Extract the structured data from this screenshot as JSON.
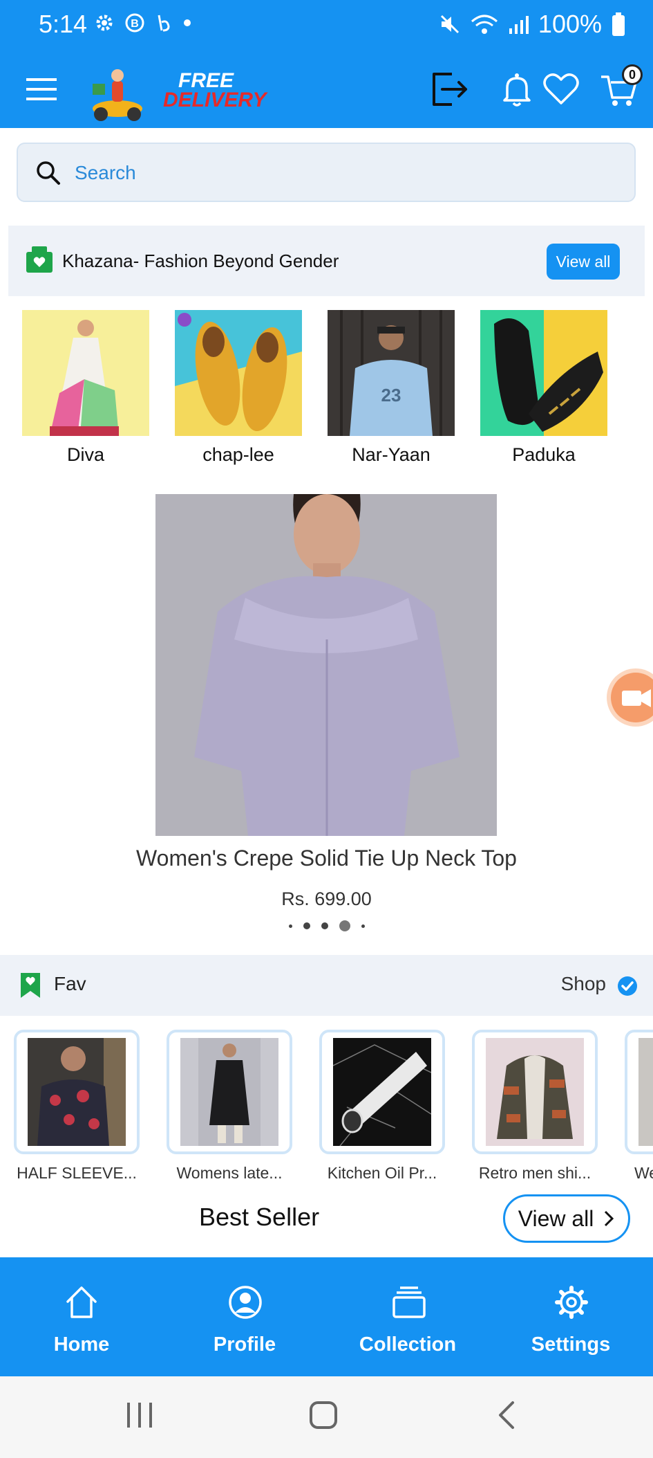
{
  "status_bar": {
    "time": "5:14",
    "battery": "100%"
  },
  "header": {
    "logo_line1": "FREE",
    "logo_line2": "DELIVERY",
    "cart_count": "0"
  },
  "search": {
    "placeholder": "Search"
  },
  "khazana": {
    "title": "Khazana- Fashion Beyond Gender",
    "view_all": "View all"
  },
  "categories": [
    {
      "label": "Diva"
    },
    {
      "label": "chap-lee"
    },
    {
      "label": "Nar-Yaan"
    },
    {
      "label": "Paduka"
    }
  ],
  "carousel": {
    "title": "Women's Crepe Solid Tie Up Neck Top",
    "price": "Rs. 699.00",
    "active_index": 3,
    "slide_count": 5
  },
  "fav": {
    "title": "Fav",
    "shop": "Shop"
  },
  "fav_items": [
    {
      "label": "HALF SLEEVE..."
    },
    {
      "label": "Womens late..."
    },
    {
      "label": "Kitchen Oil Pr..."
    },
    {
      "label": "Retro men shi..."
    },
    {
      "label": "We"
    }
  ],
  "best_seller": {
    "title": "Best Seller",
    "view_all": "View all"
  },
  "bottom_nav": [
    {
      "label": "Home"
    },
    {
      "label": "Profile"
    },
    {
      "label": "Collection"
    },
    {
      "label": "Settings"
    }
  ],
  "colors": {
    "primary": "#1592f2",
    "section_bg": "#eef2f8",
    "green": "#1ea54a"
  }
}
